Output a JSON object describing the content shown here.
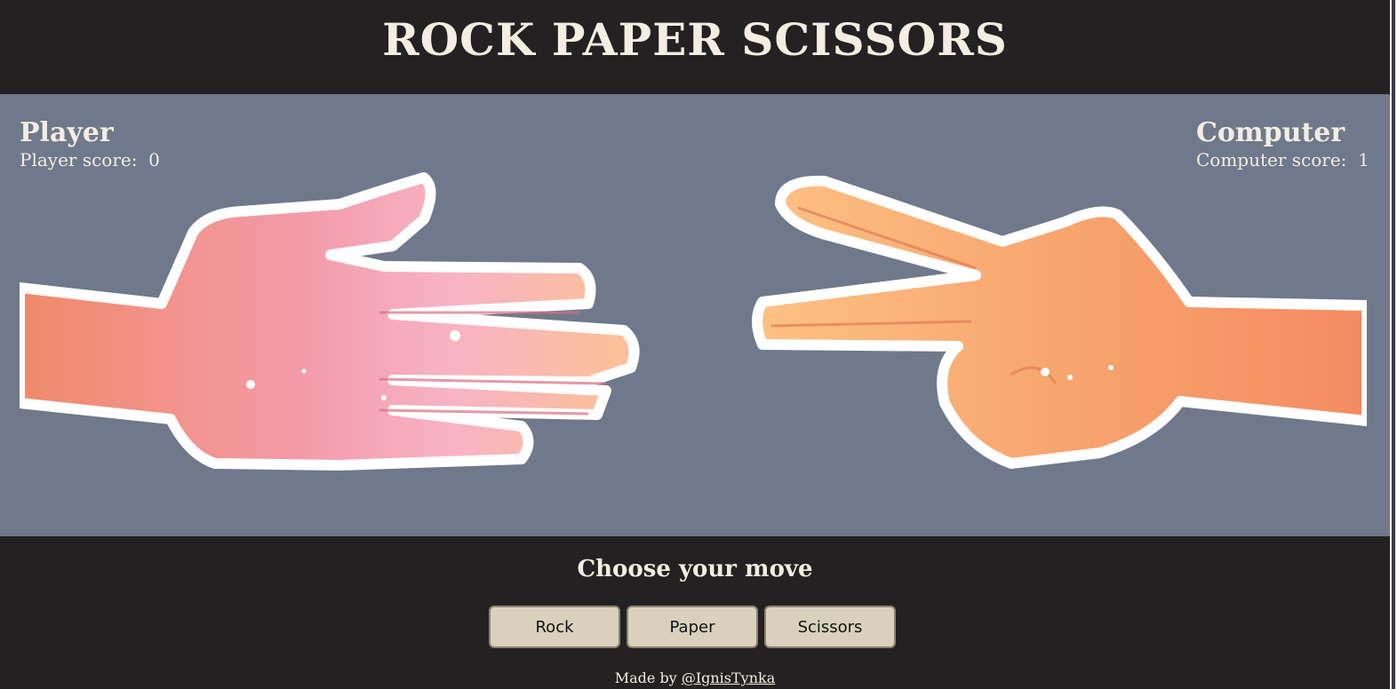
{
  "header": {
    "title": "ROCK PAPER SCISSORS"
  },
  "player": {
    "label": "Player",
    "score_text": "Player score:  0",
    "score": 0,
    "hand_icon": "paper-hand-icon"
  },
  "computer": {
    "label": "Computer",
    "score_text": "Computer score:  1",
    "score": 1,
    "hand_icon": "scissors-hand-icon"
  },
  "controls": {
    "prompt": "Choose your move",
    "buttons": [
      {
        "label": "Rock"
      },
      {
        "label": "Paper"
      },
      {
        "label": "Scissors"
      }
    ]
  },
  "footer": {
    "prefix": "Made by ",
    "author": "@IgnisTynka"
  },
  "colors": {
    "header_bg": "#232122",
    "arena_bg": "#6f798b",
    "button_bg": "#d9d1bb",
    "text": "#f3ede2"
  }
}
